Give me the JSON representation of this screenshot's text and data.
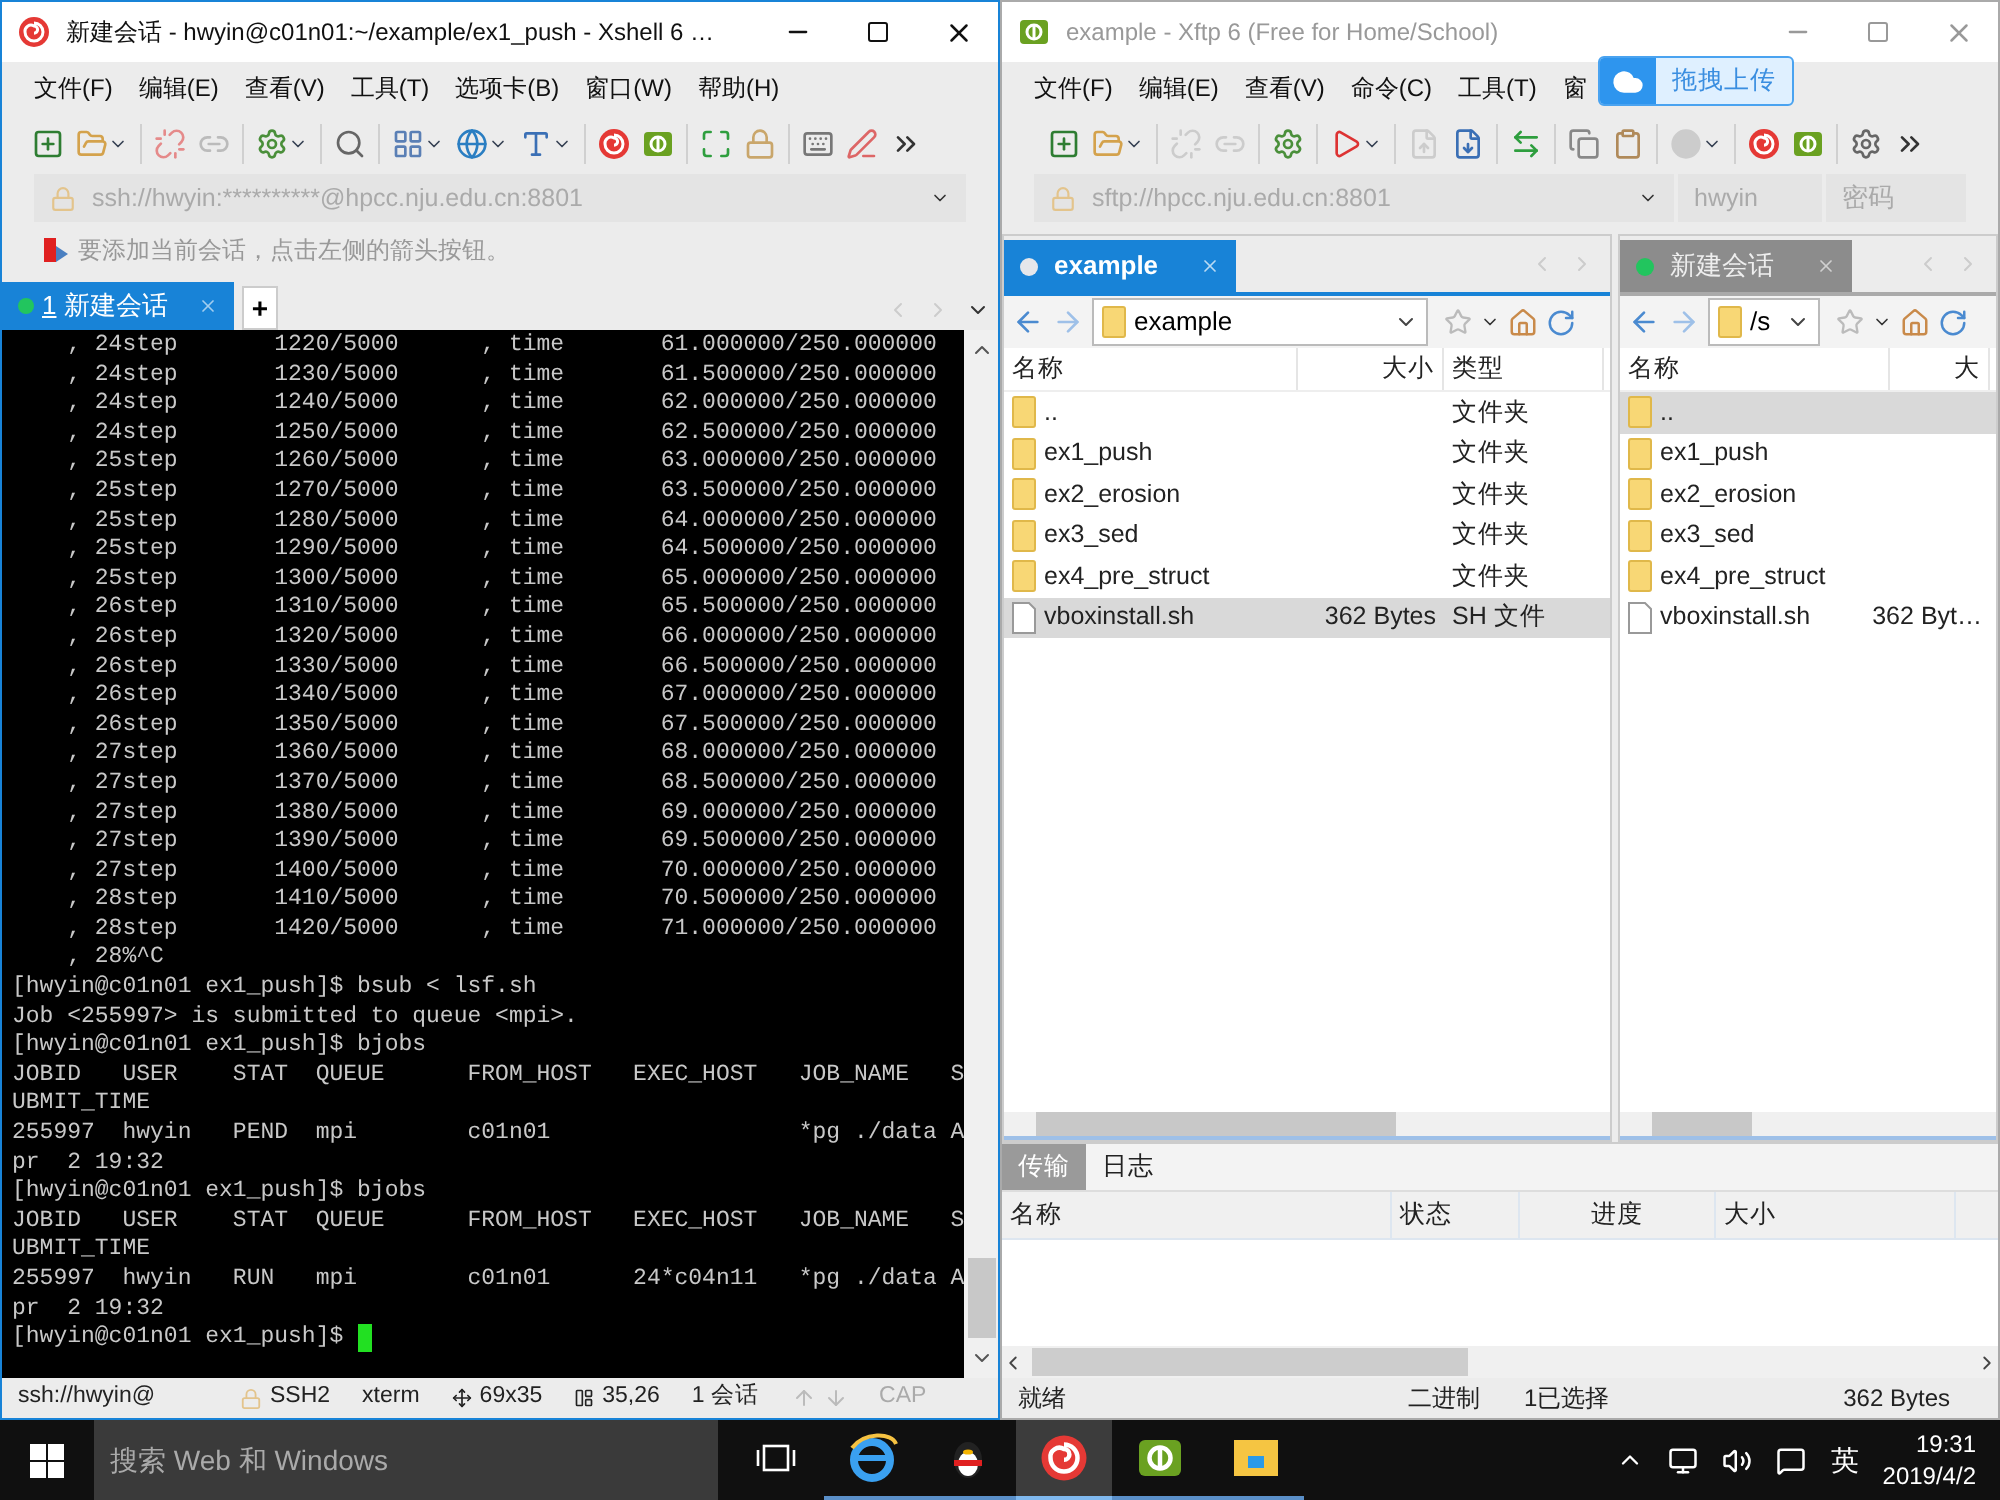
{
  "xshell": {
    "active": true,
    "title": "新建会话 - hwyin@c01n01:~/example/ex1_push - Xshell 6 …",
    "menu": [
      "文件(F)",
      "编辑(E)",
      "查看(V)",
      "工具(T)",
      "选项卡(B)",
      "窗口(W)",
      "帮助(H)"
    ],
    "address": "ssh://hwyin:**********@hpcc.nju.edu.cn:8801",
    "hint": "要添加当前会话，点击左侧的箭头按钮。",
    "tabs": [
      {
        "number": "1",
        "label": "新建会话",
        "selected": true,
        "color": "#22c55e"
      }
    ],
    "add_tab": "+",
    "terminal_lines": [
      "    , 24step       1220/5000      , time       61.000000/250.000000",
      "    , 24step       1230/5000      , time       61.500000/250.000000",
      "    , 24step       1240/5000      , time       62.000000/250.000000",
      "    , 24step       1250/5000      , time       62.500000/250.000000",
      "    , 25step       1260/5000      , time       63.000000/250.000000",
      "    , 25step       1270/5000      , time       63.500000/250.000000",
      "    , 25step       1280/5000      , time       64.000000/250.000000",
      "    , 25step       1290/5000      , time       64.500000/250.000000",
      "    , 25step       1300/5000      , time       65.000000/250.000000",
      "    , 26step       1310/5000      , time       65.500000/250.000000",
      "    , 26step       1320/5000      , time       66.000000/250.000000",
      "    , 26step       1330/5000      , time       66.500000/250.000000",
      "    , 26step       1340/5000      , time       67.000000/250.000000",
      "    , 26step       1350/5000      , time       67.500000/250.000000",
      "    , 27step       1360/5000      , time       68.000000/250.000000",
      "    , 27step       1370/5000      , time       68.500000/250.000000",
      "    , 27step       1380/5000      , time       69.000000/250.000000",
      "    , 27step       1390/5000      , time       69.500000/250.000000",
      "    , 27step       1400/5000      , time       70.000000/250.000000",
      "    , 28step       1410/5000      , time       70.500000/250.000000",
      "    , 28step       1420/5000      , time       71.000000/250.000000",
      "    , 28%^C",
      "[hwyin@c01n01 ex1_push]$ bsub < lsf.sh",
      "Job <255997> is submitted to queue <mpi>.",
      "[hwyin@c01n01 ex1_push]$ bjobs",
      "JOBID   USER    STAT  QUEUE      FROM_HOST   EXEC_HOST   JOB_NAME   S",
      "UBMIT_TIME",
      "255997  hwyin   PEND  mpi        c01n01                  *pg ./data A",
      "pr  2 19:32",
      "[hwyin@c01n01 ex1_push]$ bjobs",
      "JOBID   USER    STAT  QUEUE      FROM_HOST   EXEC_HOST   JOB_NAME   S",
      "UBMIT_TIME",
      "255997  hwyin   RUN   mpi        c01n01      24*c04n11   *pg ./data A",
      "pr  2 19:32"
    ],
    "prompt": "[hwyin@c01n01 ex1_push]$ ",
    "status": {
      "address": "ssh://hwyin@",
      "protocol": "SSH2",
      "terminal": "xterm",
      "size": "69x35",
      "cursor": "35,26",
      "sessions": "1 会话",
      "caps": "CAP"
    }
  },
  "xftp": {
    "active": false,
    "title": "example - Xftp 6 (Free for Home/School)",
    "menu": [
      "文件(F)",
      "编辑(E)",
      "查看(V)",
      "命令(C)",
      "工具(T)",
      "窗"
    ],
    "upload_popup": "拖拽上传",
    "address": "sftp://hpcc.nju.edu.cn:8801",
    "user": "hwyin",
    "password_placeholder": "密码",
    "panes": [
      {
        "tab": {
          "label": "example",
          "color": "#e5e7eb",
          "selected": true
        },
        "path": "example",
        "columns": [
          "名称",
          "大小",
          "类型"
        ],
        "rows": [
          {
            "kind": "folder",
            "name": "..",
            "type": "文件夹",
            "selected": false
          },
          {
            "kind": "folder",
            "name": "ex1_push",
            "type": "文件夹",
            "selected": false
          },
          {
            "kind": "folder",
            "name": "ex2_erosion",
            "type": "文件夹",
            "selected": false
          },
          {
            "kind": "folder",
            "name": "ex3_sed",
            "type": "文件夹",
            "selected": false
          },
          {
            "kind": "folder",
            "name": "ex4_pre_struct",
            "type": "文件夹",
            "selected": false
          },
          {
            "kind": "file",
            "name": "vboxinstall.sh",
            "size": "362 Bytes",
            "type": "SH 文件",
            "selected": true
          }
        ]
      },
      {
        "tab": {
          "label": "新建会话",
          "color": "#22c55e",
          "selected": false
        },
        "path": "/s",
        "columns": [
          "名称",
          "大"
        ],
        "rows": [
          {
            "kind": "folder",
            "name": "..",
            "selected": true
          },
          {
            "kind": "folder",
            "name": "ex1_push",
            "selected": false
          },
          {
            "kind": "folder",
            "name": "ex2_erosion",
            "selected": false
          },
          {
            "kind": "folder",
            "name": "ex3_sed",
            "selected": false
          },
          {
            "kind": "folder",
            "name": "ex4_pre_struct",
            "selected": false
          },
          {
            "kind": "file",
            "name": "vboxinstall.sh",
            "size": "362 Byt…",
            "selected": false
          }
        ]
      }
    ],
    "transfer": {
      "tabs": [
        {
          "label": "传输",
          "selected": true
        },
        {
          "label": "日志",
          "selected": false
        }
      ],
      "columns": [
        "名称",
        "状态",
        "进度",
        "大小"
      ]
    },
    "status": [
      "就绪",
      "二进制",
      "1已选择",
      "362 Bytes"
    ]
  },
  "taskbar": {
    "search_placeholder": "搜索 Web 和 Windows",
    "apps": [
      {
        "kind": "task-view",
        "selected": false
      },
      {
        "kind": "ie",
        "selected": false
      },
      {
        "kind": "qq",
        "selected": false
      },
      {
        "kind": "xshell",
        "selected": true
      },
      {
        "kind": "xftp",
        "selected": false
      },
      {
        "kind": "explorer",
        "selected": false
      }
    ],
    "ime": "英",
    "time": "19:31",
    "date": "2019/4/2"
  }
}
